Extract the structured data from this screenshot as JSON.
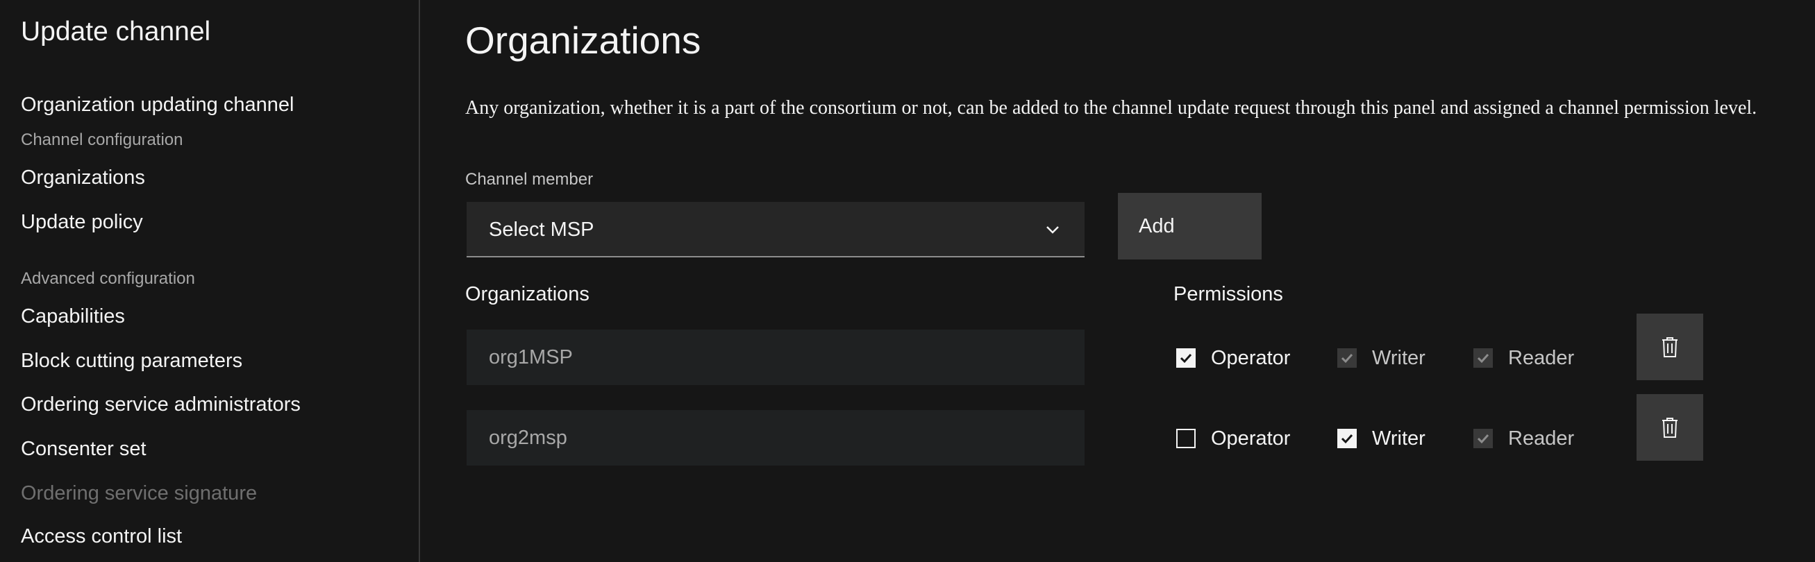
{
  "sidebar": {
    "title": "Update channel",
    "items": [
      {
        "label": "Organization updating channel"
      },
      {
        "label": "Channel configuration"
      },
      {
        "label": "Organizations"
      },
      {
        "label": "Update policy"
      },
      {
        "label": "Advanced configuration"
      },
      {
        "label": "Capabilities"
      },
      {
        "label": "Block cutting parameters"
      },
      {
        "label": "Ordering service administrators"
      },
      {
        "label": "Consenter set"
      },
      {
        "label": "Ordering service signature"
      },
      {
        "label": "Access control list"
      }
    ]
  },
  "main": {
    "title": "Organizations",
    "description": "Any organization, whether it is a part of the consortium or not, can be added to the channel update request through this panel and assigned a channel permission level.",
    "channel_member": {
      "label": "Channel member",
      "selected": "Select MSP"
    },
    "add_label": "Add",
    "organizations_label": "Organizations",
    "permissions_label": "Permissions",
    "rows": [
      {
        "org": "org1MSP",
        "permissions": [
          {
            "label": "Operator",
            "checked": true,
            "disabled": false
          },
          {
            "label": "Writer",
            "checked": true,
            "disabled": true
          },
          {
            "label": "Reader",
            "checked": true,
            "disabled": true
          }
        ]
      },
      {
        "org": "org2msp",
        "permissions": [
          {
            "label": "Operator",
            "checked": false,
            "disabled": false
          },
          {
            "label": "Writer",
            "checked": true,
            "disabled": false
          },
          {
            "label": "Reader",
            "checked": true,
            "disabled": true
          }
        ]
      }
    ]
  },
  "icons": {
    "dropdown": "chevron-down-icon",
    "delete": "trash-icon",
    "check": "checkmark-icon"
  },
  "colors": {
    "background": "#161616",
    "field": "#262626",
    "button": "#393939",
    "text": "#f4f4f4",
    "muted": "#a8a8a8"
  }
}
